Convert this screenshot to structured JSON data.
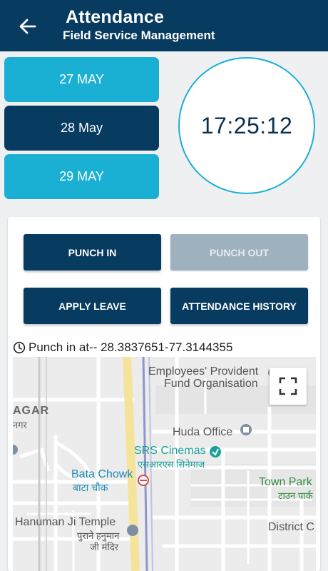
{
  "header": {
    "title": "Attendance",
    "subtitle": "Field Service Management"
  },
  "dates": [
    {
      "label": "27 MAY",
      "selected": false
    },
    {
      "label": "28 May",
      "selected": true
    },
    {
      "label": "29 MAY",
      "selected": false
    }
  ],
  "clock": {
    "time": "17:25:12"
  },
  "actions": {
    "punch_in": "PUNCH IN",
    "punch_out": "PUNCH OUT",
    "apply_leave": "APPLY LEAVE",
    "history": "ATTENDANCE HISTORY"
  },
  "punch_status": "Punch in at-- 28.3837651-77.3144355",
  "map": {
    "labels": {
      "epfo_en": "Employees' Provident",
      "epfo_en2": "Fund Organisation",
      "nagar_en": "AGAR",
      "nagar_hi": "नगर",
      "huda": "Huda Office",
      "srs_en": "SRS Cinemas",
      "srs_hi": "एसआरएस सिनेमाज",
      "bata_en": "Bata Chowk",
      "bata_hi": "बाटा चौक",
      "town_en": "Town Park",
      "town_hi": "टाउन पार्क",
      "hanuman_en": "Hanuman Ji Temple",
      "hanuman_hi": "पुराने हनुमान",
      "hanuman_hi2": "जी मंदिर",
      "district": "District C"
    }
  },
  "colors": {
    "primary": "#073b60",
    "accent": "#1ab0d4",
    "disabled": "#9eb1bf",
    "park_label": "#2e8b3e",
    "poi_teal": "#1aa09a",
    "transit_blue": "#1e88b5"
  }
}
